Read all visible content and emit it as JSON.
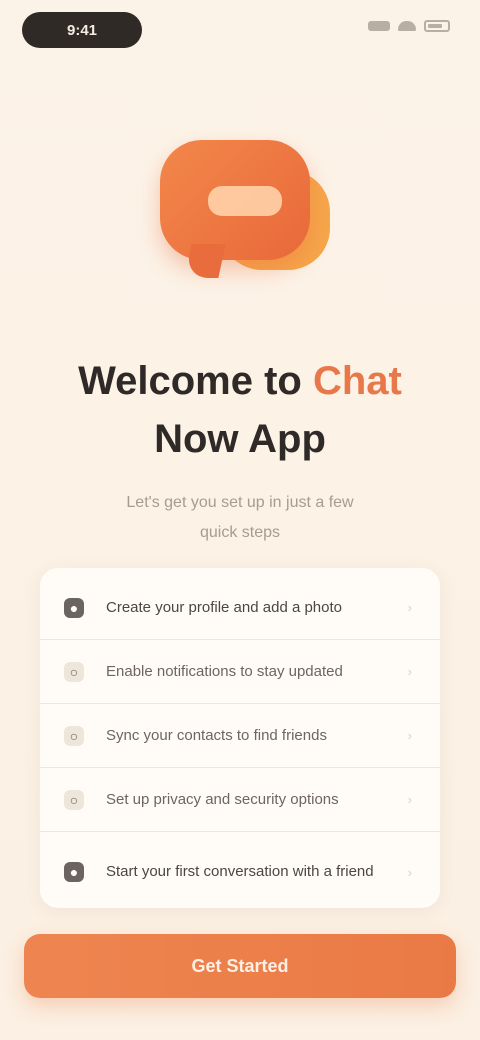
{
  "status_bar": {
    "time": "9:41"
  },
  "app_icon": {
    "name": "chat-bubble-icon"
  },
  "header": {
    "title_part1": "Welcome to ",
    "title_accent": "Chat",
    "title_part2": "Now App",
    "subtitle": "Let's get you set up in just a few quick steps"
  },
  "steps": [
    {
      "icon": "user-icon",
      "label": "Create your profile and add a photo"
    },
    {
      "icon": "bell-icon",
      "label": "Enable notifications to stay updated"
    },
    {
      "icon": "contacts-icon",
      "label": "Sync your contacts to find friends"
    },
    {
      "icon": "lock-icon",
      "label": "Set up privacy and security options"
    },
    {
      "icon": "chat-icon",
      "label": "Start your first conversation with a friend"
    }
  ],
  "button": {
    "label": "Get Started"
  },
  "colors": {
    "accent": "#E8784A",
    "background": "#FCF3E8"
  }
}
